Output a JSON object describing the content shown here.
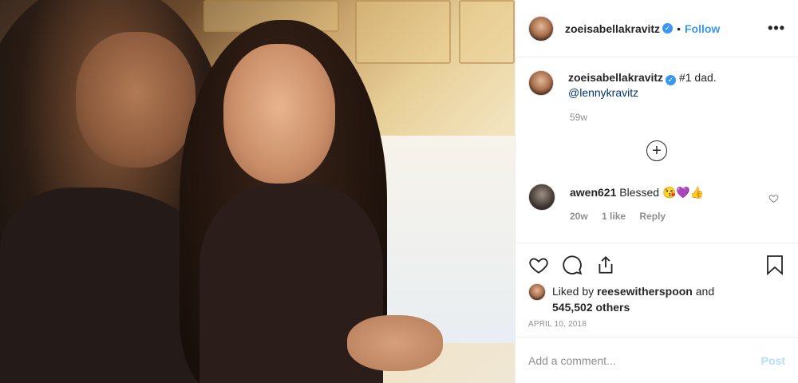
{
  "post": {
    "username": "zoeisabellakravitz",
    "verified_mark": "✓",
    "separator": "•",
    "follow_label": "Follow",
    "more_label": "•••",
    "caption": {
      "username": "zoeisabellakravitz",
      "text": "#1 dad.",
      "mention": "@lennykravitz",
      "time": "59w"
    },
    "load_more_label": "+",
    "comment": {
      "username": "awen621",
      "text": "Blessed",
      "emoji": "😘💜👍",
      "time": "20w",
      "likes": "1 like",
      "reply": "Reply"
    },
    "likes": {
      "prefix": "Liked by",
      "user": "reesewitherspoon",
      "middle": "and",
      "count": "545,502 others"
    },
    "date": "APRIL 10, 2018",
    "add_comment_placeholder": "Add a comment...",
    "post_label": "Post",
    "icons": {
      "like": "heart-icon",
      "comment": "comment-icon",
      "share": "share-icon",
      "save": "bookmark-icon",
      "comment_like": "heart-icon",
      "load_more": "plus-circle-icon"
    },
    "colors": {
      "accent": "#3897f0",
      "post_disabled": "#b2dffc",
      "muted": "#8e8e8e"
    }
  }
}
